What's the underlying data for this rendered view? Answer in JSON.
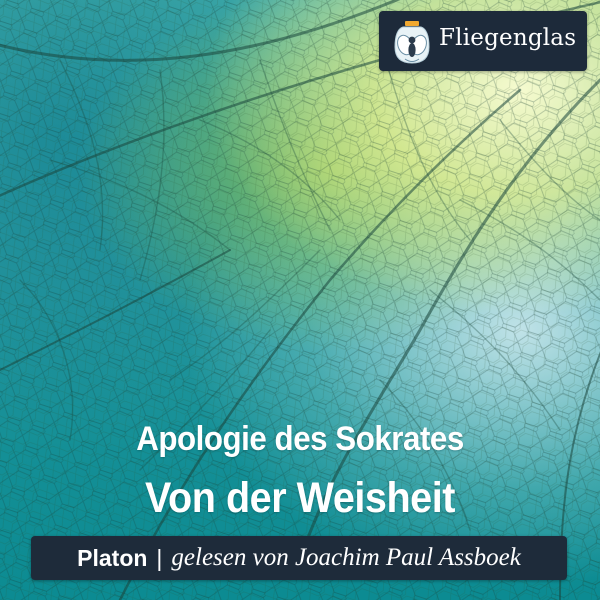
{
  "logo": {
    "text": "Fliegenglas",
    "icon": "fly-in-jar-icon"
  },
  "title": {
    "line1": "Apologie des Sokrates",
    "line2": "Von der Weisheit"
  },
  "author_bar": {
    "author": "Platon",
    "separator": "|",
    "reader": "gelesen von Joachim Paul Assboek"
  },
  "background": {
    "motif": "skeleton-leaf-veins",
    "colors": [
      "#0c8b92",
      "#3faaa9",
      "#b7d43a",
      "#fffbd2"
    ]
  }
}
